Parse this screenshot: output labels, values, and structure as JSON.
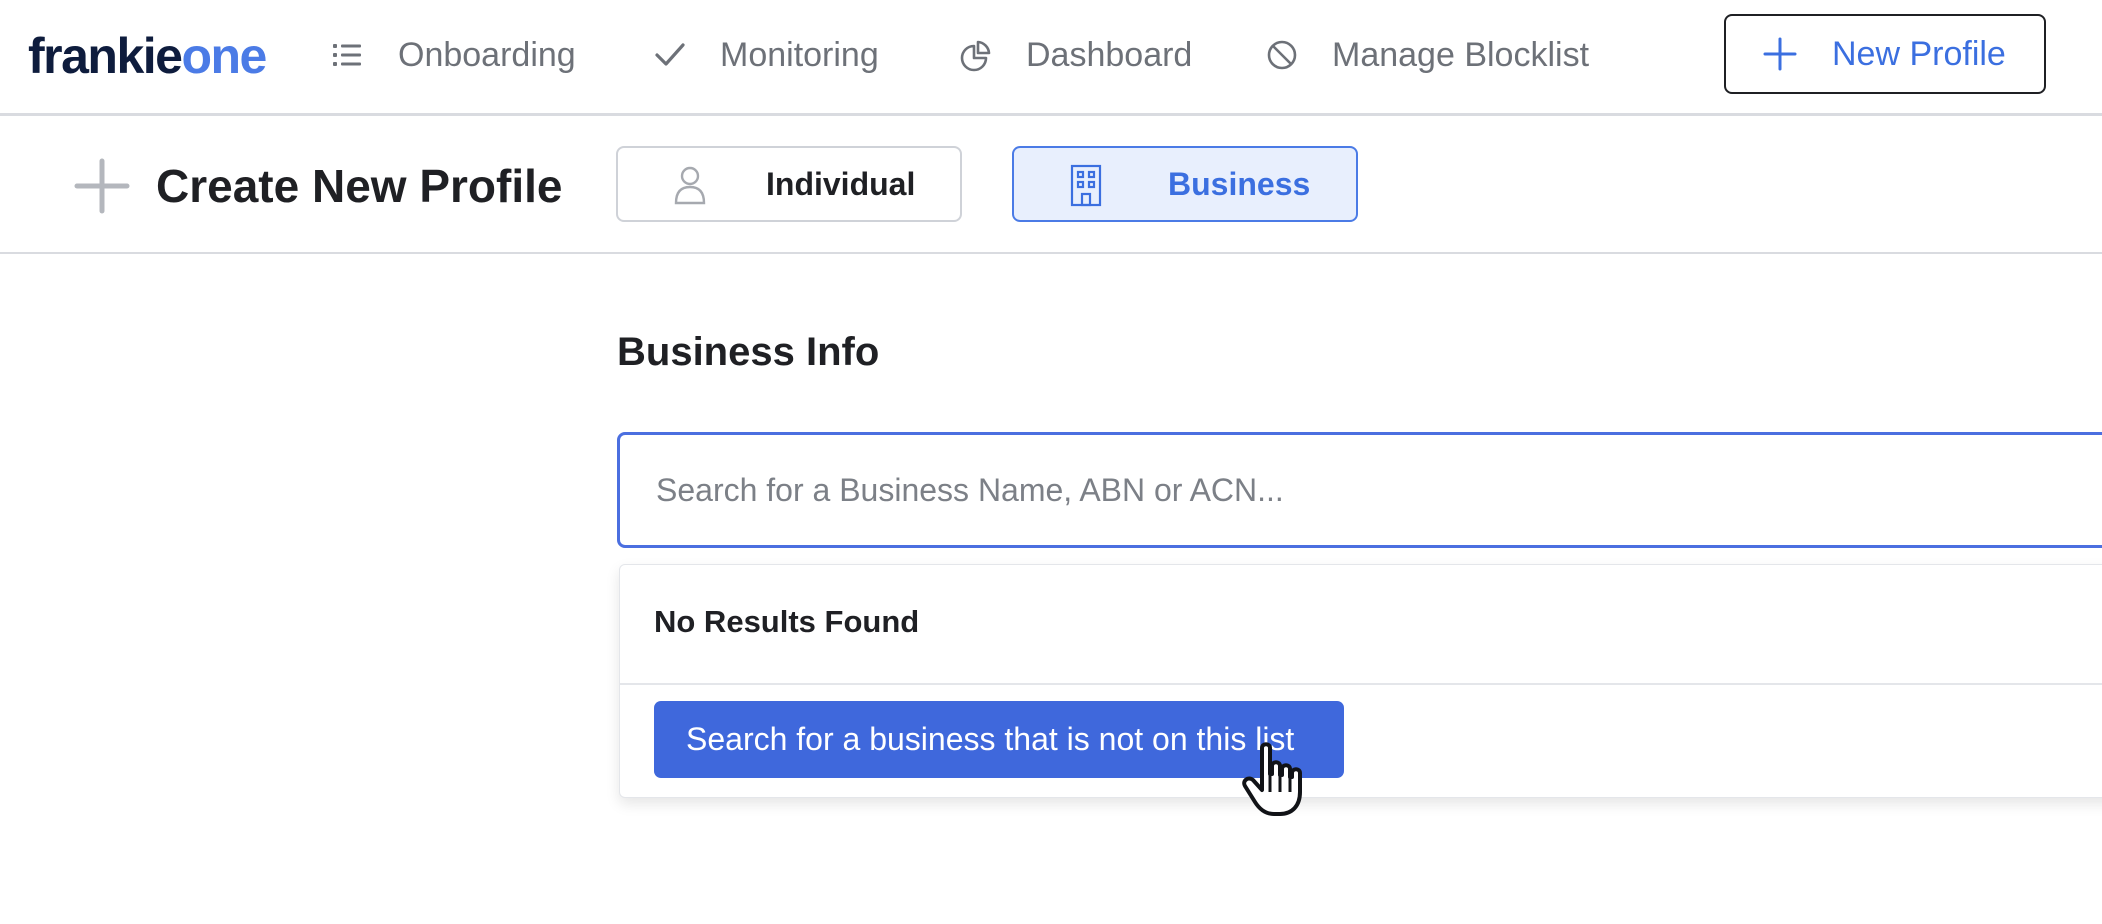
{
  "brand": {
    "logo_part1": "frankie",
    "logo_part2": "one",
    "primary_color": "#0e1c3d",
    "accent_color": "#4b7be6"
  },
  "nav": {
    "items": [
      {
        "label": "Onboarding",
        "icon": "list-icon"
      },
      {
        "label": "Monitoring",
        "icon": "check-icon"
      },
      {
        "label": "Dashboard",
        "icon": "pie-chart-icon"
      },
      {
        "label": "Manage Blocklist",
        "icon": "block-icon"
      }
    ],
    "new_profile_label": "New Profile"
  },
  "subheader": {
    "title": "Create New Profile",
    "types": [
      {
        "label": "Individual",
        "icon": "person-icon",
        "selected": false
      },
      {
        "label": "Business",
        "icon": "building-icon",
        "selected": true
      }
    ]
  },
  "main": {
    "section_title": "Business Info",
    "search": {
      "placeholder": "Search for a Business Name, ABN or ACN...",
      "value": ""
    },
    "dropdown": {
      "empty_text": "No Results Found",
      "action_label": "Search for a business that is not on this list"
    }
  }
}
